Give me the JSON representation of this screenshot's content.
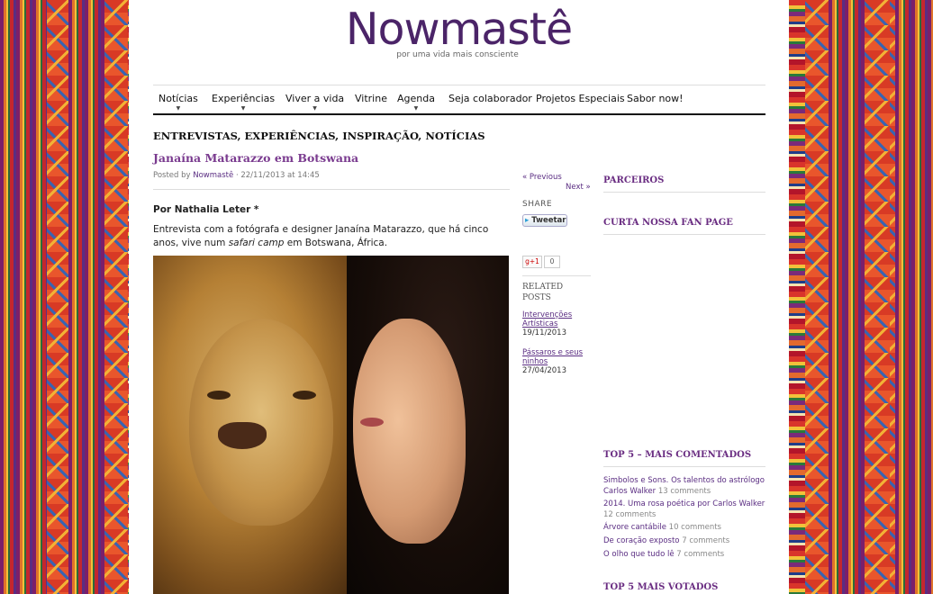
{
  "site": {
    "logo": "Nowmastê",
    "tagline": "por uma vida mais consciente"
  },
  "nav": {
    "items": [
      {
        "label": "Notícias",
        "dropdown": true
      },
      {
        "label": "Experiências",
        "dropdown": true
      },
      {
        "label": "Viver a vida",
        "dropdown": true
      },
      {
        "label": "Vitrine",
        "dropdown": false
      },
      {
        "label": "Agenda",
        "dropdown": true
      },
      {
        "label": "Seja colaborador",
        "dropdown": false
      },
      {
        "label": "Projetos Especiais",
        "dropdown": false
      },
      {
        "label": "Sabor now!",
        "dropdown": false
      }
    ]
  },
  "post": {
    "categories": "ENTREVISTAS, EXPERIÊNCIAS, INSPIRAÇÃO, NOTÍCIAS",
    "title": "Janaína Matarazzo em Botswana",
    "meta_prefix": "Posted by",
    "author": "Nowmastê",
    "date": "22/11/2013 at 14:45",
    "byline": "Por Nathalia Leter *",
    "intro_a": "Entrevista com a fotógrafa e designer Janaína Matarazzo, que há cinco anos, vive num ",
    "intro_em": "safari camp",
    "intro_b": " em Botswana, África."
  },
  "side": {
    "previous": "« Previous",
    "next": "Next »",
    "share": "SHARE",
    "tweet": "Tweetar",
    "gplus": "+1",
    "gcount": "0",
    "related_label_1": "RELATED",
    "related_label_2": "POSTS",
    "related": [
      {
        "title": "Intervenções Artísticas",
        "date": "19/11/2013"
      },
      {
        "title": "Pássaros e seus ninhos",
        "date": "27/04/2013"
      }
    ]
  },
  "sidebar": {
    "partners": "PARCEIROS",
    "fanpage": "CURTA NOSSA FAN PAGE",
    "top_commented_title": "TOP 5 – MAIS COMENTADOS",
    "top_commented": [
      {
        "title": "Simbolos e Sons. Os talentos do astrólogo Carlos Walker",
        "comments": "13 comments"
      },
      {
        "title": "2014. Uma rosa poética por Carlos Walker",
        "comments": "12 comments"
      },
      {
        "title": "Árvore cantábile",
        "comments": "10 comments"
      },
      {
        "title": "De coração exposto",
        "comments": "7 comments"
      },
      {
        "title": "O olho que tudo lê",
        "comments": "7 comments"
      }
    ],
    "top_voted_title": "TOP 5 MAIS VOTADOS"
  },
  "colors": {
    "brand_purple": "#4b2468",
    "link_purple": "#5a2d82",
    "title_purple": "#7a3b8f"
  }
}
